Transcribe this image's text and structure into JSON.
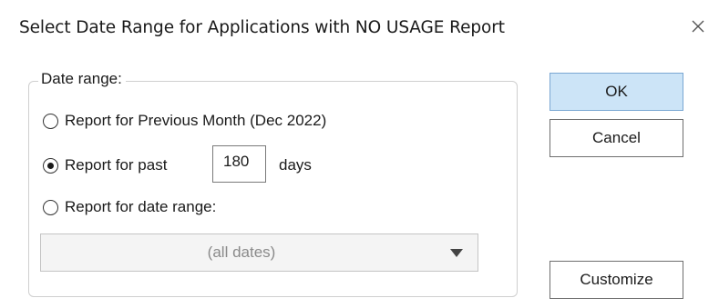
{
  "dialog": {
    "title": "Select Date Range for Applications with NO USAGE Report",
    "close_icon": "close-icon"
  },
  "date_range": {
    "legend": "Date range:",
    "options": [
      {
        "label": "Report for Previous Month (Dec 2022)",
        "checked": false
      },
      {
        "label": "Report for past",
        "checked": true
      },
      {
        "label": "Report for date range:",
        "checked": false
      }
    ],
    "past_days_value": "180",
    "past_days_suffix": "days",
    "combo": {
      "selected": "(all dates)",
      "icon": "chevron-down-icon"
    }
  },
  "buttons": {
    "ok": "OK",
    "cancel": "Cancel",
    "customize": "Customize"
  },
  "colors": {
    "ok_button_bg": "#cce4f7",
    "ok_button_border": "#7aa7d3",
    "disabled_text": "#8a8a8a"
  }
}
